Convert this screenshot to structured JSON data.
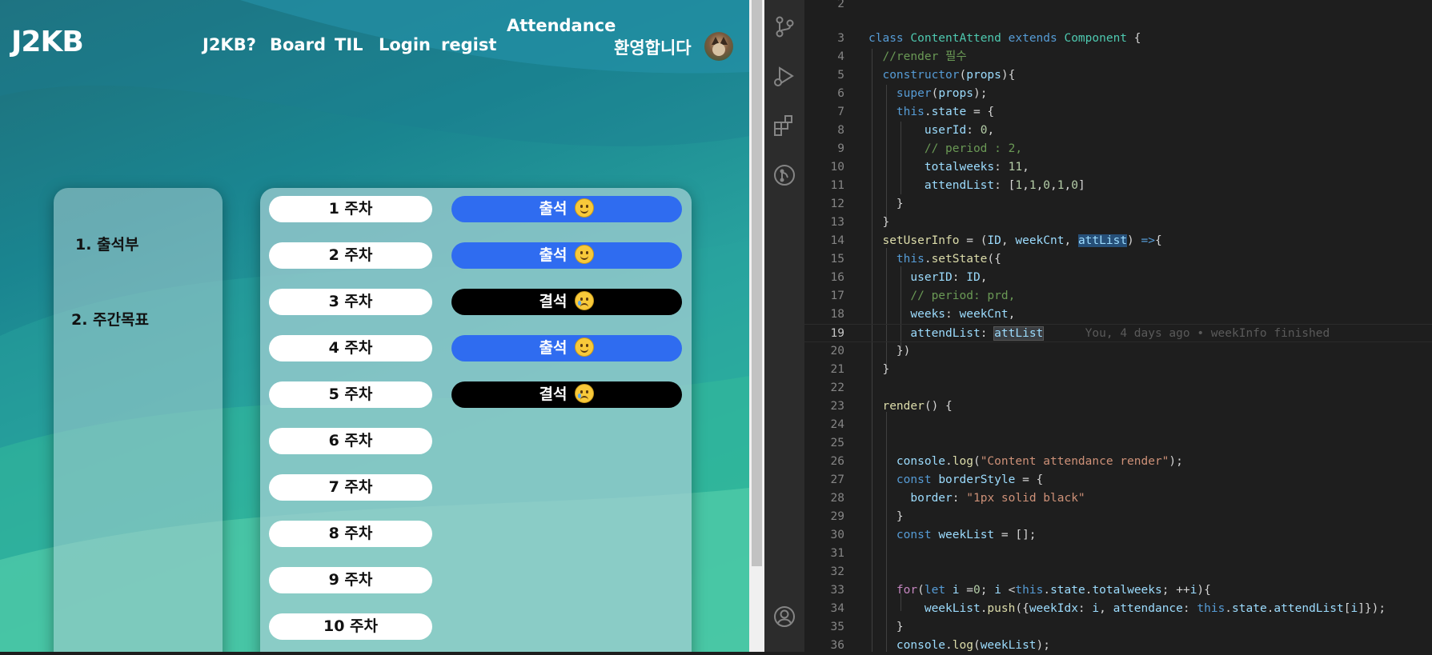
{
  "web": {
    "logo": "J2KB",
    "nav": {
      "about": "J2KB?",
      "board": "Board",
      "til": "TIL",
      "login": "Login",
      "regist": "regist",
      "attendance": "Attendance"
    },
    "welcome": "환영합니다",
    "menu": [
      "1. 출석부",
      "2. 주간목표"
    ],
    "weeks": [
      "1 주차",
      "2 주차",
      "3 주차",
      "4 주차",
      "5 주차",
      "6 주차",
      "7 주차",
      "8 주차",
      "9 주차",
      "10 주차"
    ],
    "attendance": [
      {
        "label": "출석",
        "status": "present",
        "emoji": "smiling-face-icon"
      },
      {
        "label": "출석",
        "status": "present",
        "emoji": "smiling-face-icon"
      },
      {
        "label": "결석",
        "status": "absent",
        "emoji": "crying-face-icon"
      },
      {
        "label": "출석",
        "status": "present",
        "emoji": "smiling-face-icon"
      },
      {
        "label": "결석",
        "status": "absent",
        "emoji": "crying-face-icon"
      }
    ],
    "colors": {
      "present": "#2f6cf0",
      "absent": "#000000"
    }
  },
  "editor": {
    "active_line": 19,
    "blame": "You, 4 days ago • weekInfo finished",
    "line_numbers": [
      2,
      3,
      4,
      5,
      6,
      7,
      8,
      9,
      10,
      11,
      12,
      13,
      14,
      15,
      16,
      17,
      18,
      19,
      20,
      21,
      22,
      23,
      24,
      25,
      26,
      27,
      28,
      29,
      30,
      31,
      32,
      33,
      34,
      35,
      36
    ]
  }
}
